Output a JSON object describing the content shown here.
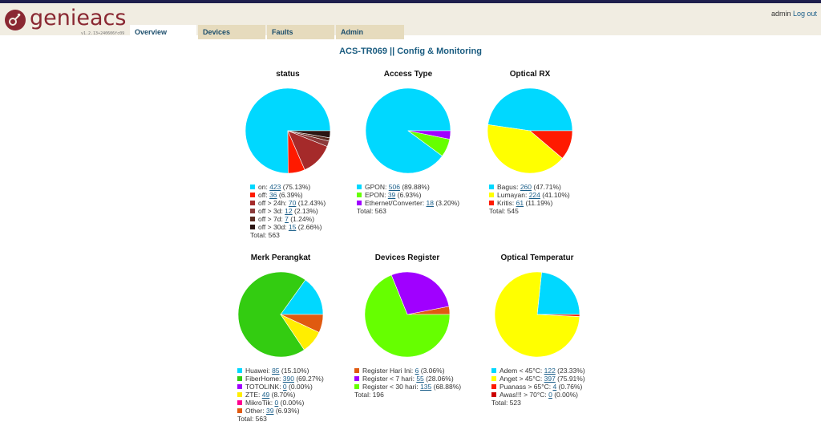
{
  "app": {
    "logo_text": "genieacs",
    "version": "v1.2.13+240606fc09",
    "user": "admin",
    "logout_label": "Log out"
  },
  "tabs": [
    {
      "label": "Overview"
    },
    {
      "label": "Devices"
    },
    {
      "label": "Faults"
    },
    {
      "label": "Admin"
    }
  ],
  "page_title": "ACS-TR069 || Config & Monitoring",
  "chart_data": [
    {
      "type": "pie",
      "title": "status",
      "slices": [
        {
          "label": "on",
          "count": 423,
          "pct": "75.13%",
          "color": "#00d8ff"
        },
        {
          "label": "off",
          "count": 36,
          "pct": "6.39%",
          "color": "#ff1a00"
        },
        {
          "label": "off > 24h",
          "count": 70,
          "pct": "12.43%",
          "color": "#a52a2a"
        },
        {
          "label": "off > 3d",
          "count": 12,
          "pct": "2.13%",
          "color": "#8b3a3a"
        },
        {
          "label": "off > 7d",
          "count": 7,
          "pct": "1.24%",
          "color": "#5a2a20"
        },
        {
          "label": "off > 30d",
          "count": 15,
          "pct": "2.66%",
          "color": "#2a1512"
        }
      ],
      "total_label": "Total: 563"
    },
    {
      "type": "pie",
      "title": "Access Type",
      "slices": [
        {
          "label": "GPON",
          "count": 506,
          "pct": "89.88%",
          "color": "#00d8ff"
        },
        {
          "label": "EPON",
          "count": 39,
          "pct": "6.93%",
          "color": "#66ff00"
        },
        {
          "label": "Ethernet/Converter",
          "count": 18,
          "pct": "3.20%",
          "color": "#a000ff"
        }
      ],
      "total_label": "Total: 563"
    },
    {
      "type": "pie",
      "title": "Optical RX",
      "slices": [
        {
          "label": "Bagus",
          "count": 260,
          "pct": "47.71%",
          "color": "#00d8ff"
        },
        {
          "label": "Lumayan",
          "count": 224,
          "pct": "41.10%",
          "color": "#ffff00"
        },
        {
          "label": "Kritis",
          "count": 61,
          "pct": "11.19%",
          "color": "#ff1a00"
        }
      ],
      "total_label": "Total: 545"
    },
    {
      "type": "pie",
      "title": "Merk Perangkat",
      "slices": [
        {
          "label": "Huawei",
          "count": 85,
          "pct": "15.10%",
          "color": "#00d8ff"
        },
        {
          "label": "FiberHome",
          "count": 390,
          "pct": "69.27%",
          "color": "#33cc11"
        },
        {
          "label": "TOTOLINK",
          "count": 0,
          "pct": "0.00%",
          "color": "#a000ff"
        },
        {
          "label": "ZTE",
          "count": 49,
          "pct": "8.70%",
          "color": "#ffee00"
        },
        {
          "label": "MikroTik",
          "count": 0,
          "pct": "0.00%",
          "color": "#ff0090"
        },
        {
          "label": "Other",
          "count": 39,
          "pct": "6.93%",
          "color": "#e05a10"
        }
      ],
      "total_label": "Total: 563"
    },
    {
      "type": "pie",
      "title": "Devices Register",
      "slices": [
        {
          "label": "Register Hari Ini",
          "count": 6,
          "pct": "3.06%",
          "color": "#e05a10"
        },
        {
          "label": "Register < 7 hari",
          "count": 55,
          "pct": "28.06%",
          "color": "#a000ff"
        },
        {
          "label": "Register < 30 hari",
          "count": 135,
          "pct": "68.88%",
          "color": "#66ff00"
        }
      ],
      "total_label": "Total: 196"
    },
    {
      "type": "pie",
      "title": "Optical Temperatur",
      "slices": [
        {
          "label": "Adem < 45°C",
          "count": 122,
          "pct": "23.33%",
          "color": "#00d8ff"
        },
        {
          "label": "Anget > 45°C",
          "count": 397,
          "pct": "75.91%",
          "color": "#ffff00"
        },
        {
          "label": "Puanass > 65°C",
          "count": 4,
          "pct": "0.76%",
          "color": "#ff1a00"
        },
        {
          "label": "Awas!!! > 70°C",
          "count": 0,
          "pct": "0.00%",
          "color": "#cc0000"
        }
      ],
      "total_label": "Total: 523"
    }
  ]
}
